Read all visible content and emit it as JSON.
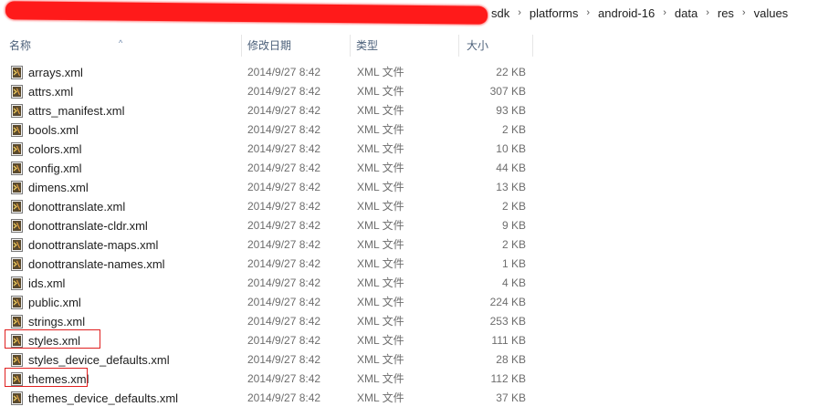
{
  "breadcrumb": [
    "sdk",
    "platforms",
    "android-16",
    "data",
    "res",
    "values"
  ],
  "breadcrumb_sep": "›",
  "columns": {
    "name": "名称",
    "date": "修改日期",
    "type": "类型",
    "size": "大小"
  },
  "files": [
    {
      "name": "arrays.xml",
      "date": "2014/9/27 8:42",
      "type": "XML 文件",
      "size": "22 KB"
    },
    {
      "name": "attrs.xml",
      "date": "2014/9/27 8:42",
      "type": "XML 文件",
      "size": "307 KB"
    },
    {
      "name": "attrs_manifest.xml",
      "date": "2014/9/27 8:42",
      "type": "XML 文件",
      "size": "93 KB"
    },
    {
      "name": "bools.xml",
      "date": "2014/9/27 8:42",
      "type": "XML 文件",
      "size": "2 KB"
    },
    {
      "name": "colors.xml",
      "date": "2014/9/27 8:42",
      "type": "XML 文件",
      "size": "10 KB"
    },
    {
      "name": "config.xml",
      "date": "2014/9/27 8:42",
      "type": "XML 文件",
      "size": "44 KB"
    },
    {
      "name": "dimens.xml",
      "date": "2014/9/27 8:42",
      "type": "XML 文件",
      "size": "13 KB"
    },
    {
      "name": "donottranslate.xml",
      "date": "2014/9/27 8:42",
      "type": "XML 文件",
      "size": "2 KB"
    },
    {
      "name": "donottranslate-cldr.xml",
      "date": "2014/9/27 8:42",
      "type": "XML 文件",
      "size": "9 KB"
    },
    {
      "name": "donottranslate-maps.xml",
      "date": "2014/9/27 8:42",
      "type": "XML 文件",
      "size": "2 KB"
    },
    {
      "name": "donottranslate-names.xml",
      "date": "2014/9/27 8:42",
      "type": "XML 文件",
      "size": "1 KB"
    },
    {
      "name": "ids.xml",
      "date": "2014/9/27 8:42",
      "type": "XML 文件",
      "size": "4 KB"
    },
    {
      "name": "public.xml",
      "date": "2014/9/27 8:42",
      "type": "XML 文件",
      "size": "224 KB"
    },
    {
      "name": "strings.xml",
      "date": "2014/9/27 8:42",
      "type": "XML 文件",
      "size": "253 KB"
    },
    {
      "name": "styles.xml",
      "date": "2014/9/27 8:42",
      "type": "XML 文件",
      "size": "111 KB",
      "highlighted": true
    },
    {
      "name": "styles_device_defaults.xml",
      "date": "2014/9/27 8:42",
      "type": "XML 文件",
      "size": "28 KB"
    },
    {
      "name": "themes.xml",
      "date": "2014/9/27 8:42",
      "type": "XML 文件",
      "size": "112 KB",
      "highlighted": true
    },
    {
      "name": "themes_device_defaults.xml",
      "date": "2014/9/27 8:42",
      "type": "XML 文件",
      "size": "37 KB"
    }
  ],
  "icons": {
    "file": "xml-file-icon",
    "sort": "sort-ascending-icon"
  },
  "colors": {
    "redaction": "#ff1a1a",
    "highlight_border": "#e02020",
    "header_text": "#4c607a"
  }
}
